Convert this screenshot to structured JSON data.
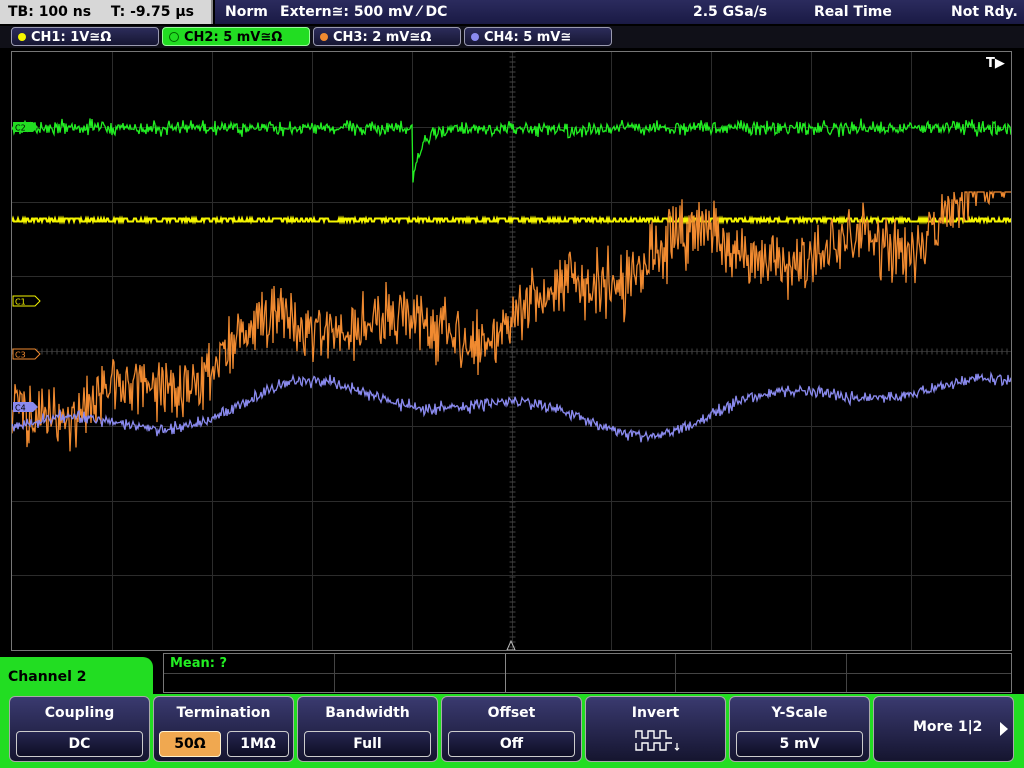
{
  "topbar": {
    "timebase": "TB: 100 ns",
    "trigger_time": "T: -9.75 µs",
    "mode": "Norm",
    "trigger_source": "Extern≅: 500 mV ⁄ DC",
    "sample_rate": "2.5 GSa/s",
    "acq_mode": "Real Time",
    "status": "Not Rdy."
  },
  "channels": [
    {
      "label": "CH1: 1V≅Ω",
      "color": "#f5f500",
      "active": false
    },
    {
      "label": "CH2: 5 mV≅Ω",
      "color": "#22dd22",
      "active": true
    },
    {
      "label": "CH3: 2 mV≅Ω",
      "color": "#f08a30",
      "active": false
    },
    {
      "label": "CH4: 5 mV≅",
      "color": "#8a8aee",
      "active": false
    }
  ],
  "screen": {
    "trigger_marker": "T▶",
    "markers": {
      "c1": "C1",
      "c2": "C2",
      "c3": "C3",
      "c4": "C4"
    }
  },
  "measurement": {
    "mean_label": "Mean: ?"
  },
  "channel_panel": {
    "title": "Channel 2"
  },
  "softkeys": {
    "coupling": {
      "title": "Coupling",
      "value": "DC"
    },
    "termination": {
      "title": "Termination",
      "option_1": "50Ω",
      "option_2": "1MΩ",
      "selected": "50Ω"
    },
    "bandwidth": {
      "title": "Bandwidth",
      "value": "Full"
    },
    "offset": {
      "title": "Offset",
      "value": "Off"
    },
    "invert": {
      "title": "Invert",
      "icon": "invert-waveform-icon"
    },
    "yscale": {
      "title": "Y-Scale",
      "value": "5 mV"
    },
    "more": {
      "label": "More 1|2",
      "icon": "arrow-right-icon"
    }
  }
}
